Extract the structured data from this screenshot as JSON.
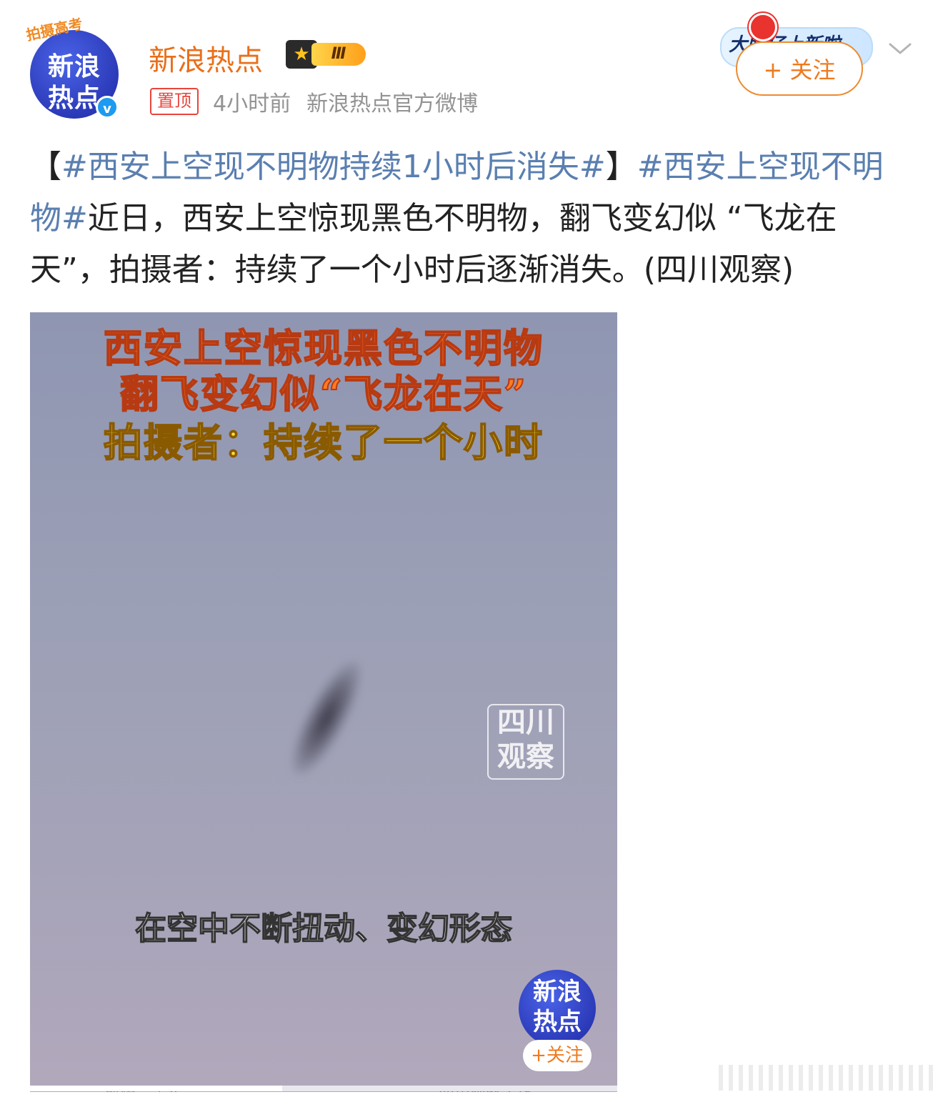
{
  "post": {
    "avatar": {
      "line1": "新浪",
      "line2": "热点",
      "frame_text": "拍摄高考"
    },
    "username": "新浪热点",
    "level_badge": "Ⅲ",
    "pin_label": "置顶",
    "time": "4小时前",
    "source": "新浪热点官方微博",
    "follow_label": "+ 关注",
    "deco_text": "大眼仔上新啦",
    "content": {
      "open_bracket": "【",
      "topic1": "#西安上空现不明物持续1小时后消失#",
      "close_bracket": "】",
      "topic2": "#西安上空现不明物#",
      "body": "近日，西安上空惊现黑色不明物，翻飞变幻似 “飞龙在天”，拍摄者：持续了一个小时后逐渐消失。(四川观察)"
    }
  },
  "media": {
    "caption_line1": "西安上空惊现黑色不明物",
    "caption_line2": "翻飞变幻似“飞龙在天”",
    "caption_line3": "拍摄者：持续了一个小时",
    "watermark_line1": "四川",
    "watermark_line2": "观察",
    "subtitle": "在空中不断扭动、变幻形态",
    "logo_line1": "新浪",
    "logo_line2": "热点",
    "follow_mini": "+关注",
    "footer_left": "剪辑：窦东",
    "footer_right": "四川观察主播",
    "progress_fraction": 0.43
  },
  "colors": {
    "username": "#ea6f1a",
    "topic": "#5a7fb0",
    "follow": "#ef7a1e",
    "pin": "#e8453c"
  }
}
